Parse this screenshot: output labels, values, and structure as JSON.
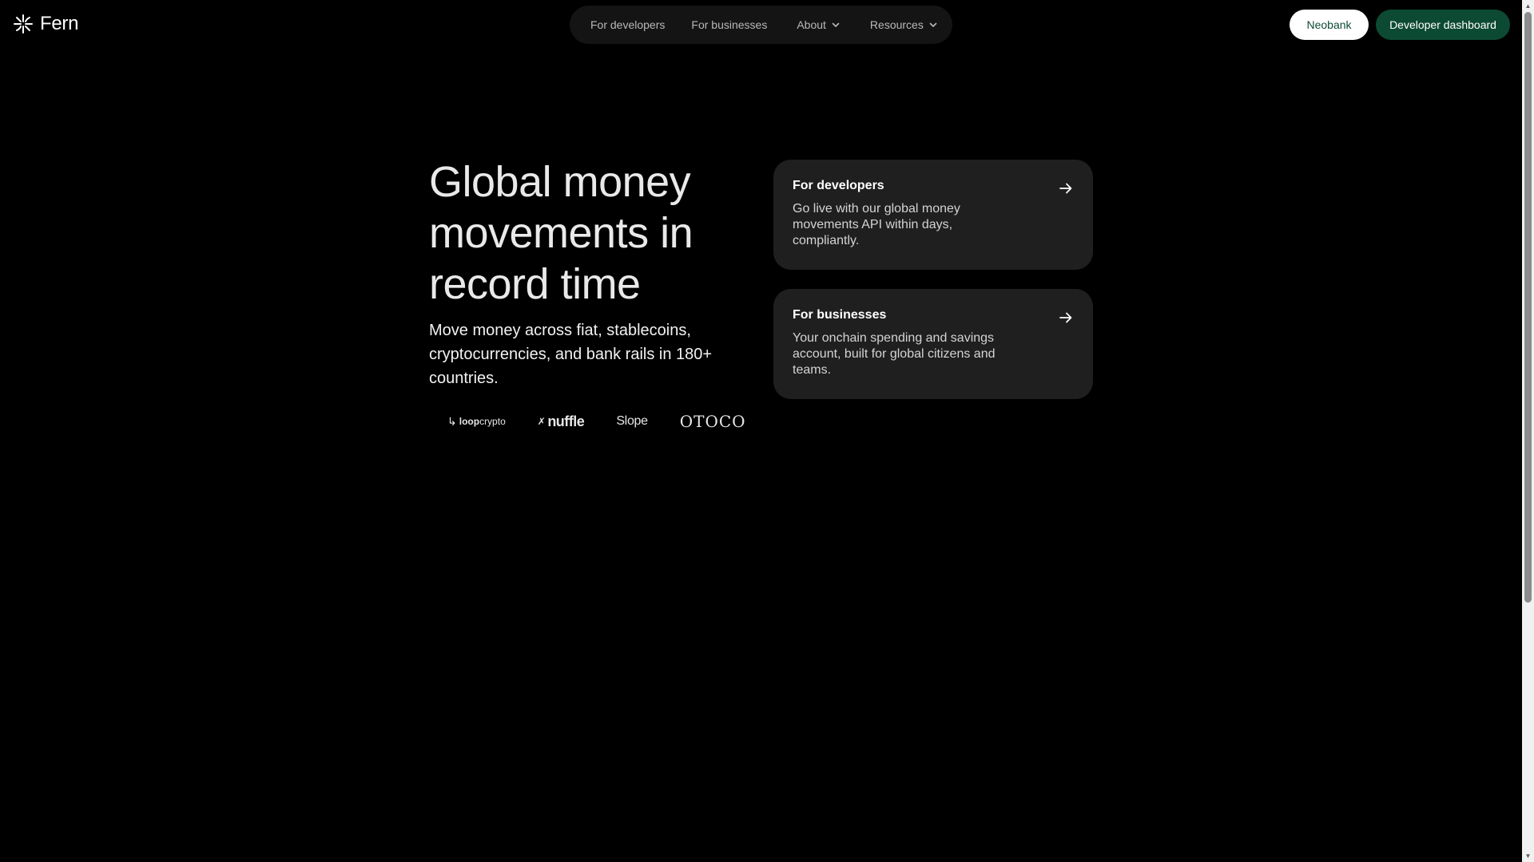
{
  "brand": {
    "name": "Fern",
    "icon": "fern-burst-icon"
  },
  "nav": {
    "items": [
      {
        "label": "For developers",
        "has_dropdown": false
      },
      {
        "label": "For businesses",
        "has_dropdown": false
      },
      {
        "label": "About",
        "has_dropdown": true
      },
      {
        "label": "Resources",
        "has_dropdown": true
      }
    ]
  },
  "header_actions": {
    "neobank_label": "Neobank",
    "dashboard_label": "Developer dashboard"
  },
  "hero": {
    "title": "Global money movements in record time",
    "subtitle": "Move money across fiat, stablecoins, cryptocurrencies, and bank rails in 180+ countries."
  },
  "partners": {
    "loop": {
      "bold": "loop",
      "rest": "crypto"
    },
    "nuffle": "nuffle",
    "slope": "Slope",
    "otoco": "OTOCO"
  },
  "cards": [
    {
      "title": "For developers",
      "description": "Go live with our global money movements API within days, compliantly.",
      "icon": "arrow-right-icon"
    },
    {
      "title": "For businesses",
      "description": "Your onchain spending and savings account, built for global citizens and teams.",
      "icon": "arrow-right-icon"
    }
  ],
  "colors": {
    "background": "#000000",
    "nav_pill": "#141414",
    "card": "#1f1f1f",
    "brand_green": "#0d4a33",
    "neobank_text": "#0f4a35"
  }
}
